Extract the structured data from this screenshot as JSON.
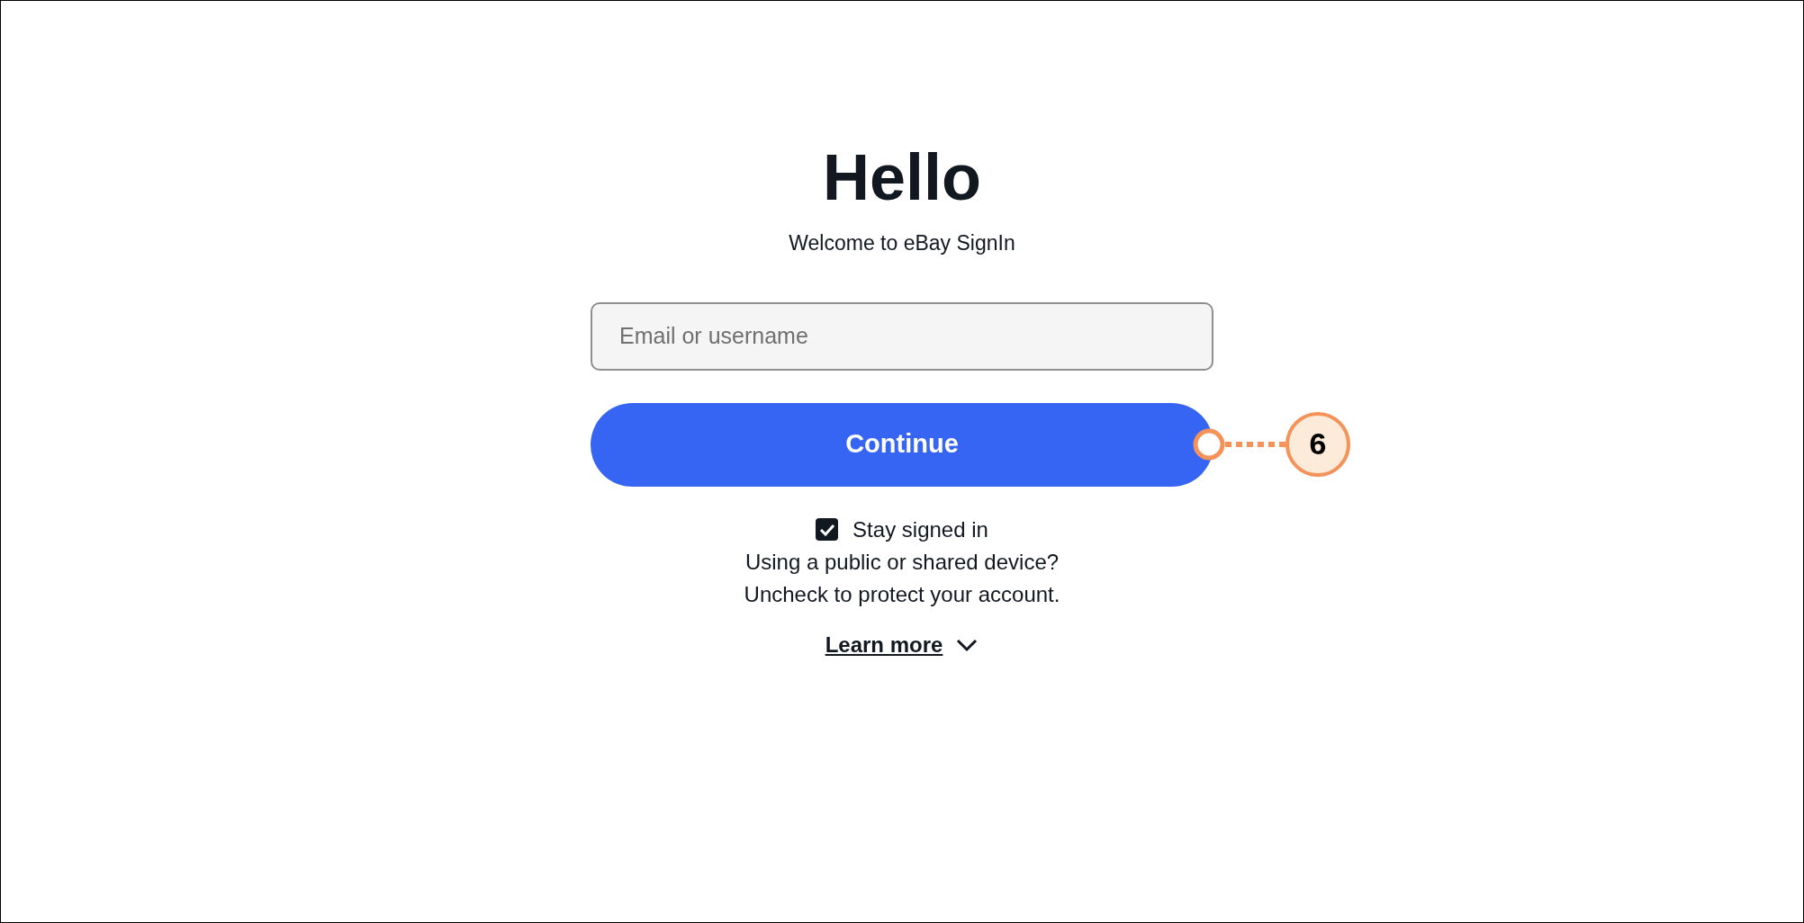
{
  "heading": "Hello",
  "subtitle": "Welcome to eBay SignIn",
  "email_field": {
    "placeholder": "Email or username"
  },
  "continue_button": {
    "label": "Continue"
  },
  "stay_signed_in": {
    "label": "Stay signed in",
    "checked": true
  },
  "notice": [
    "Using a public or shared device?",
    "Uncheck to protect your account."
  ],
  "learn_more": {
    "label": "Learn more",
    "expanded": false
  },
  "annotation": {
    "label": "6"
  }
}
